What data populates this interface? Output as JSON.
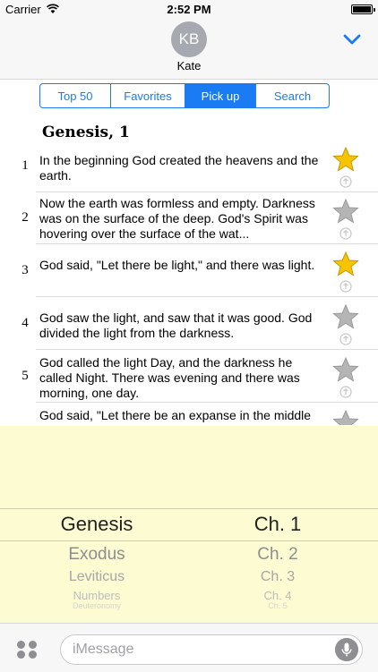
{
  "status_bar": {
    "carrier": "Carrier",
    "time": "2:52 PM",
    "battery_level": 1.0
  },
  "header": {
    "avatar_initials": "KB",
    "contact_name": "Kate"
  },
  "tabs": [
    {
      "label": "Top 50",
      "selected": false
    },
    {
      "label": "Favorites",
      "selected": false
    },
    {
      "label": "Pick up",
      "selected": true
    },
    {
      "label": "Search",
      "selected": false
    }
  ],
  "chapter_title": "Genesis, 1",
  "verses": [
    {
      "number": "1",
      "text": "In the beginning God created the heavens and the earth.",
      "favorite": true
    },
    {
      "number": "2",
      "text": "Now the earth was formless and empty. Darkness was on the surface of the deep. God's Spirit was hovering over the surface of the wat...",
      "favorite": false
    },
    {
      "number": "3",
      "text": "God said, \"Let there be light,\" and there was light.",
      "favorite": true
    },
    {
      "number": "4",
      "text": "God saw the light, and saw that it was good. God divided the light from the darkness.",
      "favorite": false
    },
    {
      "number": "5",
      "text": "God called the light Day, and the darkness he called Night. There was evening and there was morning, one day.",
      "favorite": false
    },
    {
      "number": "",
      "text": "God said, \"Let there be an expanse in the middle",
      "favorite": false
    }
  ],
  "picker": {
    "books": [
      "Genesis",
      "Exodus",
      "Leviticus",
      "Numbers",
      "Deuteronomy"
    ],
    "chapters": [
      "Ch. 1",
      "Ch. 2",
      "Ch. 3",
      "Ch. 4",
      "Ch. 5"
    ],
    "selected_book": "Genesis",
    "selected_chapter": "Ch. 1"
  },
  "input": {
    "placeholder": "iMessage",
    "value": ""
  },
  "colors": {
    "accent": "#1a7bf2",
    "picker_background": "#fdfbd2",
    "star_gold": "#f7c400",
    "star_gray": "#b5b5b5"
  }
}
